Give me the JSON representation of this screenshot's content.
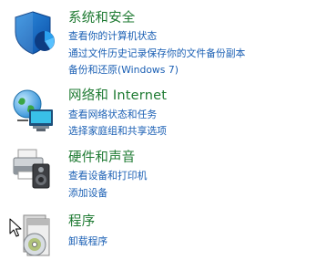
{
  "categories": [
    {
      "title": "系统和安全",
      "icon": "shield-icon",
      "links": [
        "查看你的计算机状态",
        "通过文件历史记录保存你的文件备份副本",
        "备份和还原(Windows 7)"
      ]
    },
    {
      "title": "网络和 Internet",
      "icon": "network-globe-icon",
      "links": [
        "查看网络状态和任务",
        "选择家庭组和共享选项"
      ]
    },
    {
      "title": "硬件和声音",
      "icon": "printer-speaker-icon",
      "links": [
        "查看设备和打印机",
        "添加设备"
      ]
    },
    {
      "title": "程序",
      "icon": "programs-disc-icon",
      "links": [
        "卸载程序"
      ]
    }
  ],
  "colors": {
    "title": "#1e7a32",
    "link": "#1a5fb4",
    "background": "#ffffff"
  },
  "cursor": "mouse-pointer-icon"
}
